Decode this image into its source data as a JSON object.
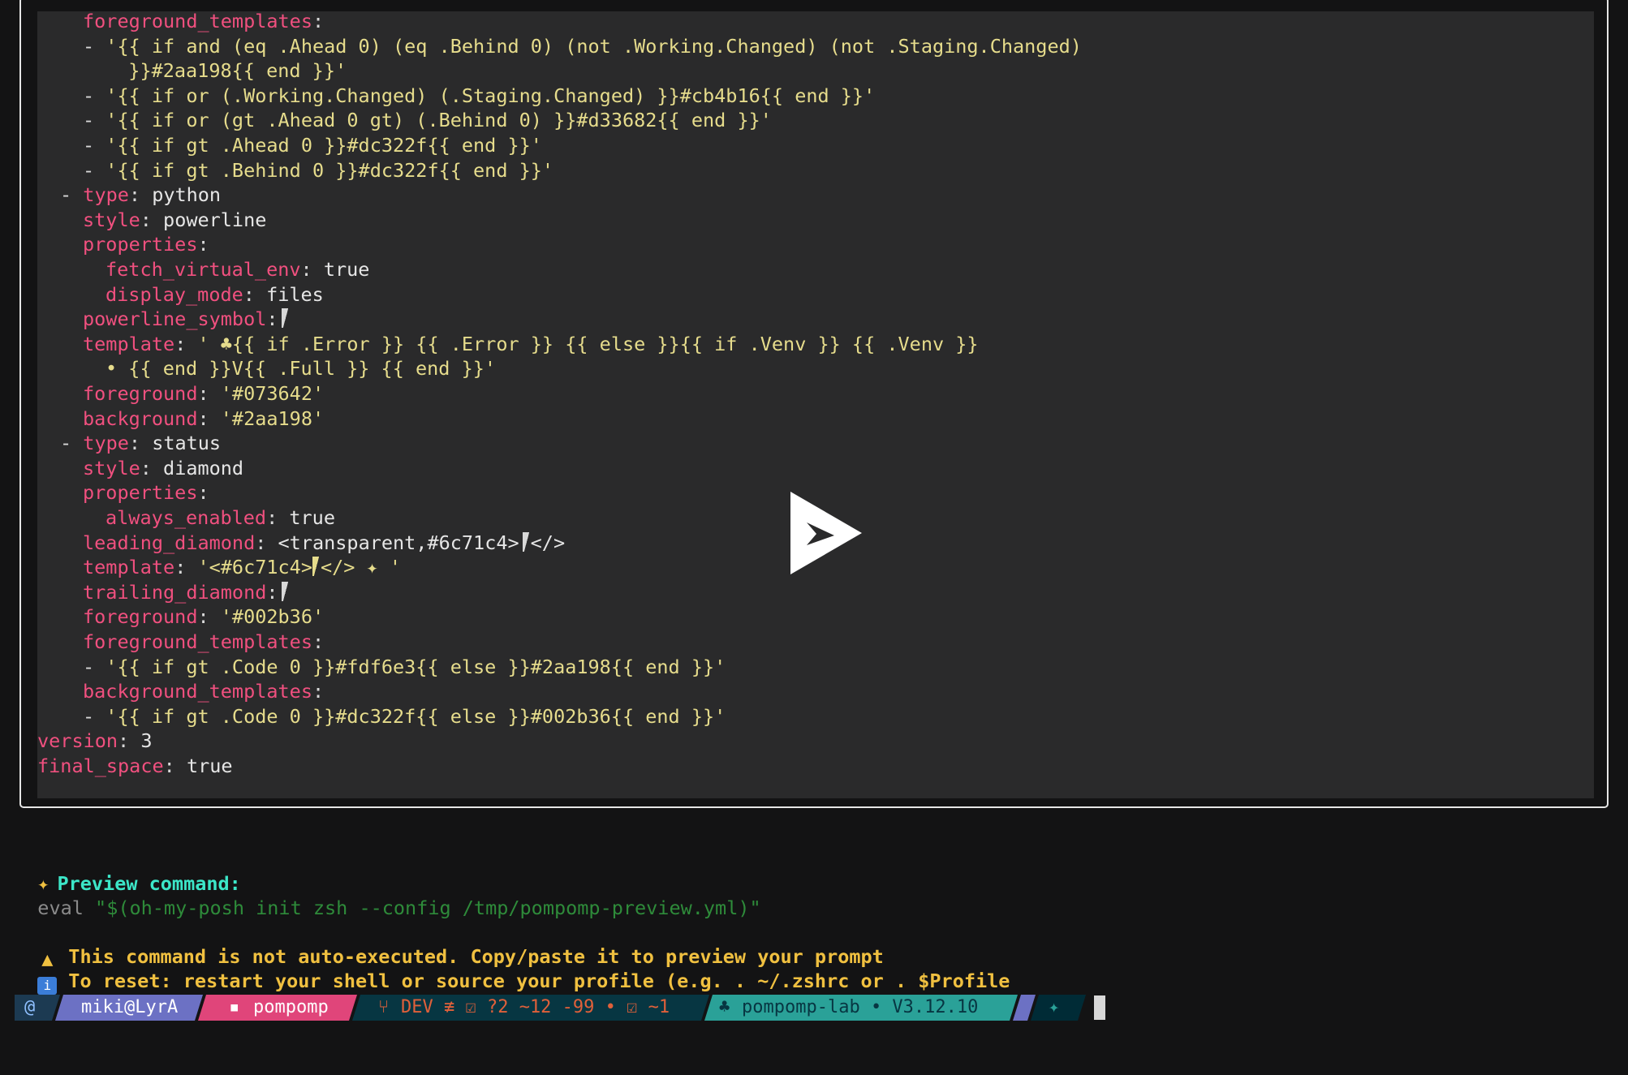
{
  "code_lines": [
    [
      {
        "t": "foreground_templates",
        "c": "k"
      },
      {
        "t": ":",
        "c": "p"
      }
    ],
    [
      {
        "t": "- ",
        "c": "p"
      },
      {
        "t": "'{{ if and (eq .Ahead 0) (eq .Behind 0) (not .Working.Changed) (not .Staging.Changed)",
        "c": "s"
      }
    ],
    [
      {
        "t": "  }}#2aa198{{ end }}'",
        "c": "s"
      }
    ],
    [
      {
        "t": "- ",
        "c": "p"
      },
      {
        "t": "'{{ if or (.Working.Changed) (.Staging.Changed) }}#cb4b16{{ end }}'",
        "c": "s"
      }
    ],
    [
      {
        "t": "- ",
        "c": "p"
      },
      {
        "t": "'{{ if or (gt .Ahead 0 gt) (.Behind 0) }}#d33682{{ end }}'",
        "c": "s"
      }
    ],
    [
      {
        "t": "- ",
        "c": "p"
      },
      {
        "t": "'{{ if gt .Ahead 0 }}#dc322f{{ end }}'",
        "c": "s"
      }
    ],
    [
      {
        "t": "- ",
        "c": "p"
      },
      {
        "t": "'{{ if gt .Behind 0 }}#dc322f{{ end }}'",
        "c": "s"
      }
    ],
    [
      {
        "t": "- ",
        "c": "p"
      },
      {
        "t": "type",
        "c": "k"
      },
      {
        "t": ": ",
        "c": "p"
      },
      {
        "t": "python",
        "c": "v"
      }
    ],
    [
      {
        "t": "style",
        "c": "k"
      },
      {
        "t": ": ",
        "c": "p"
      },
      {
        "t": "powerline",
        "c": "v"
      }
    ],
    [
      {
        "t": "properties",
        "c": "k"
      },
      {
        "t": ":",
        "c": "p"
      }
    ],
    [
      {
        "t": "fetch_virtual_env",
        "c": "k"
      },
      {
        "t": ": ",
        "c": "p"
      },
      {
        "t": "true",
        "c": "v"
      }
    ],
    [
      {
        "t": "display_mode",
        "c": "k"
      },
      {
        "t": ": ",
        "c": "p"
      },
      {
        "t": "files",
        "c": "v"
      }
    ],
    [
      {
        "t": "powerline_symbol",
        "c": "k"
      },
      {
        "t": ":",
        "c": "p"
      },
      {
        "t": "",
        "c": "sym"
      }
    ],
    [
      {
        "t": "template",
        "c": "k"
      },
      {
        "t": ": ",
        "c": "p"
      },
      {
        "t": "' ♣{{ if .Error }} {{ .Error }} {{ else }}{{ if .Venv }} {{ .Venv }}",
        "c": "s"
      }
    ],
    [
      {
        "t": "• {{ end }}V{{ .Full }} {{ end }}'",
        "c": "s"
      }
    ],
    [
      {
        "t": "foreground",
        "c": "k"
      },
      {
        "t": ": ",
        "c": "p"
      },
      {
        "t": "'#073642'",
        "c": "s"
      }
    ],
    [
      {
        "t": "background",
        "c": "k"
      },
      {
        "t": ": ",
        "c": "p"
      },
      {
        "t": "'#2aa198'",
        "c": "s"
      }
    ],
    [
      {
        "t": "- ",
        "c": "p"
      },
      {
        "t": "type",
        "c": "k"
      },
      {
        "t": ": ",
        "c": "p"
      },
      {
        "t": "status",
        "c": "v"
      }
    ],
    [
      {
        "t": "style",
        "c": "k"
      },
      {
        "t": ": ",
        "c": "p"
      },
      {
        "t": "diamond",
        "c": "v"
      }
    ],
    [
      {
        "t": "properties",
        "c": "k"
      },
      {
        "t": ":",
        "c": "p"
      }
    ],
    [
      {
        "t": "always_enabled",
        "c": "k"
      },
      {
        "t": ": ",
        "c": "p"
      },
      {
        "t": "true",
        "c": "v"
      }
    ],
    [
      {
        "t": "leading_diamond",
        "c": "k"
      },
      {
        "t": ": ",
        "c": "p"
      },
      {
        "t": "<transparent,#6c71c4>",
        "c": "v"
      },
      {
        "t": "",
        "c": "sym"
      },
      {
        "t": "</>",
        "c": "v"
      }
    ],
    [
      {
        "t": "template",
        "c": "k"
      },
      {
        "t": ": ",
        "c": "p"
      },
      {
        "t": "'<#6c71c4>",
        "c": "s"
      },
      {
        "t": "",
        "c": "symy"
      },
      {
        "t": "</> ✦ '",
        "c": "s"
      }
    ],
    [
      {
        "t": "trailing_diamond",
        "c": "k"
      },
      {
        "t": ":",
        "c": "p"
      },
      {
        "t": "",
        "c": "sym"
      }
    ],
    [
      {
        "t": "foreground",
        "c": "k"
      },
      {
        "t": ": ",
        "c": "p"
      },
      {
        "t": "'#002b36'",
        "c": "s"
      }
    ],
    [
      {
        "t": "foreground_templates",
        "c": "k"
      },
      {
        "t": ":",
        "c": "p"
      }
    ],
    [
      {
        "t": "- ",
        "c": "p"
      },
      {
        "t": "'{{ if gt .Code 0 }}#fdf6e3{{ else }}#2aa198{{ end }}'",
        "c": "s"
      }
    ],
    [
      {
        "t": "background_templates",
        "c": "k"
      },
      {
        "t": ":",
        "c": "p"
      }
    ],
    [
      {
        "t": "- ",
        "c": "p"
      },
      {
        "t": "'{{ if gt .Code 0 }}#dc322f{{ else }}#002b36{{ end }}'",
        "c": "s"
      }
    ],
    [
      {
        "t": "version",
        "c": "k"
      },
      {
        "t": ": ",
        "c": "p"
      },
      {
        "t": "3",
        "c": "v"
      }
    ],
    [
      {
        "t": "final_space",
        "c": "k"
      },
      {
        "t": ": ",
        "c": "p"
      },
      {
        "t": "true",
        "c": "v"
      }
    ]
  ],
  "output": {
    "preview_label": "Preview command:",
    "command_prefix": "eval ",
    "command_string": "\"$(oh-my-posh init zsh --config /tmp/pompomp-preview.yml)\"",
    "warning": "This command is not auto-executed. Copy/paste it to preview your prompt",
    "info": "To reset: restart your shell or source your profile (e.g. . ~/.zshrc or . $Profile"
  },
  "prompt": {
    "os_icon": "@",
    "user_host": "miki@LyrA",
    "folder_icon": "▪",
    "folder": "pompomp",
    "git_branch_icon": "⑂",
    "git_status": "DEV ≢ ☑ ?2 ~12 -99 • ☑ ~1",
    "python_icon": "♣",
    "python": "pompomp-lab • V3.12.10",
    "status_icon": "✦"
  },
  "colors": {
    "key": "#f0507f",
    "string": "#e6dc8c",
    "plain": "#e6e6e6",
    "panel": "#2a2a2b",
    "accent_preview": "#3ce6c8",
    "warning": "#f0c040",
    "command_green": "#2e8b3a",
    "segment_os": "#1c3a52",
    "segment_user": "#6c71c4",
    "segment_folder": "#e0457a",
    "segment_git": "#073642",
    "segment_python": "#2aa198",
    "segment_status": "#002b36"
  }
}
